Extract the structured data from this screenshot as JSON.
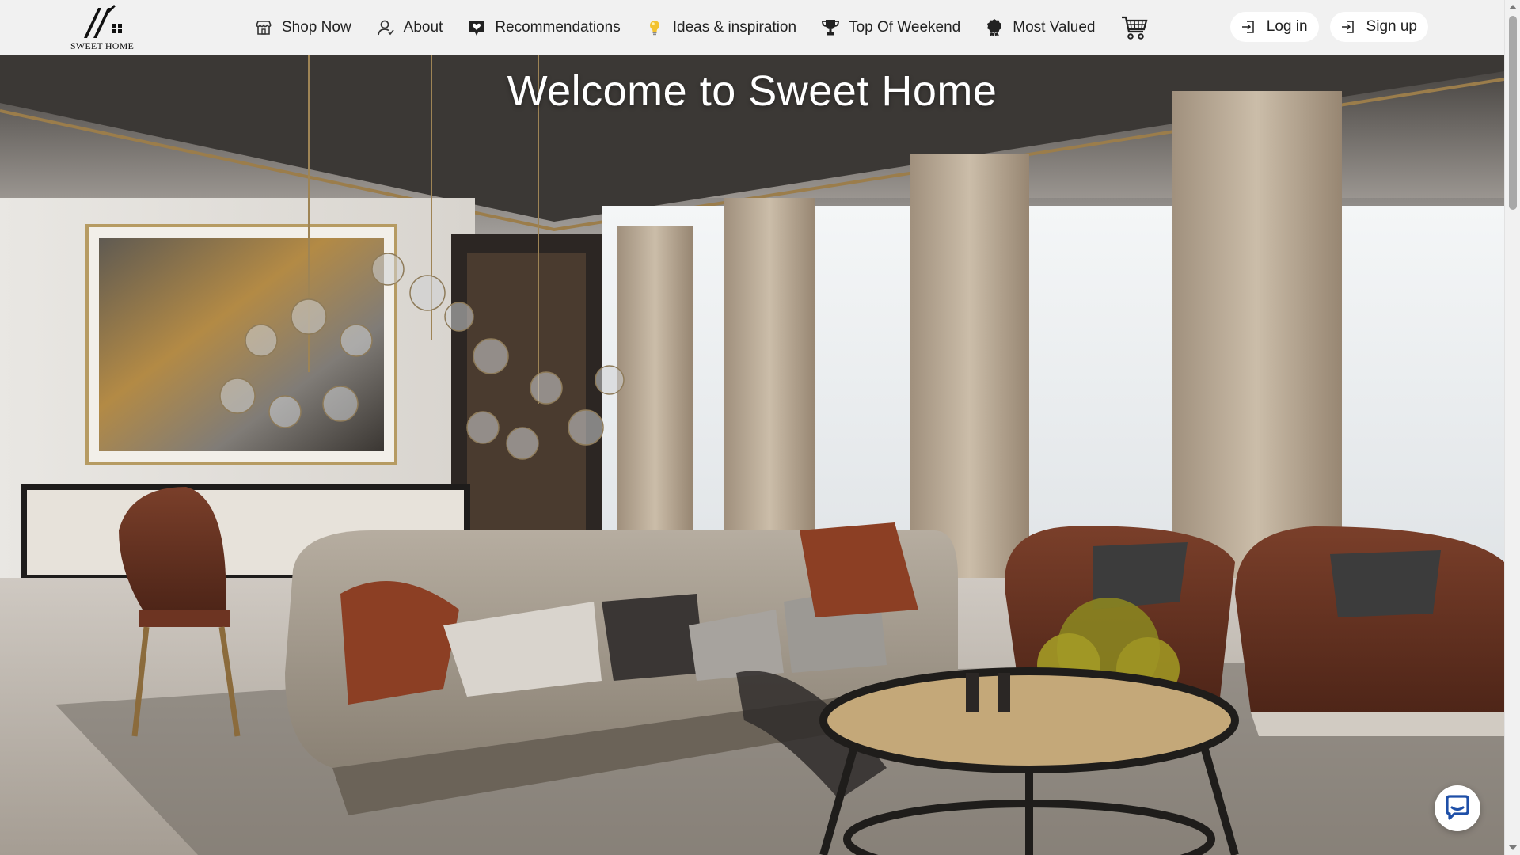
{
  "brand": {
    "name": "SWEET HOME"
  },
  "nav": {
    "items": [
      {
        "label": "Shop Now",
        "icon": "store-icon"
      },
      {
        "label": "About",
        "icon": "person-icon"
      },
      {
        "label": "Recommendations",
        "icon": "heart-badge-icon"
      },
      {
        "label": "Ideas & inspiration",
        "icon": "lightbulb-icon"
      },
      {
        "label": "Top Of Weekend",
        "icon": "trophy-icon"
      },
      {
        "label": "Most Valued",
        "icon": "award-ribbon-icon"
      }
    ],
    "cart_icon": "cart-icon"
  },
  "auth": {
    "login_label": "Log in",
    "signup_label": "Sign up"
  },
  "hero": {
    "title": "Welcome to Sweet Home"
  },
  "colors": {
    "header_bg": "#f1f1f1",
    "button_bg": "#ffffff",
    "hero_title": "#ffffff",
    "lightbulb": "#f2c230",
    "chat_icon": "#1e4fa8"
  }
}
